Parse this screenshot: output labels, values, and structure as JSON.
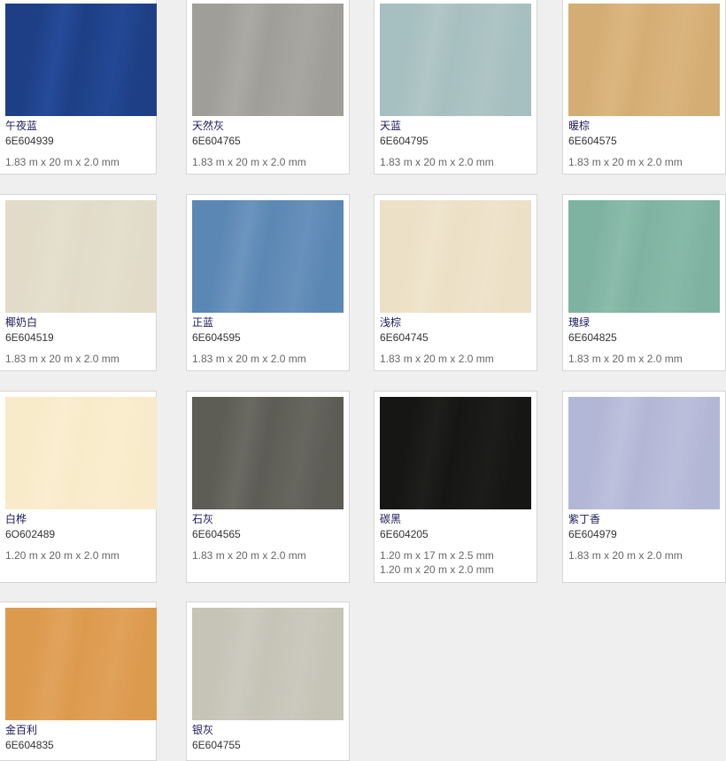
{
  "products": [
    {
      "name": "午夜蓝",
      "code": "6E604939",
      "sizes": [
        "1.83 m x 20 m x 2.0 mm"
      ],
      "color": "#1e3f85",
      "accent": "#3363c2"
    },
    {
      "name": "天然灰",
      "code": "6E604765",
      "sizes": [
        "1.83 m x 20 m x 2.0 mm"
      ],
      "color": "#a09e98",
      "accent": "#c2c0ba"
    },
    {
      "name": "天蓝",
      "code": "6E604795",
      "sizes": [
        "1.83 m x 20 m x 2.0 mm"
      ],
      "color": "#a6bfc0",
      "accent": "#c6d6d6"
    },
    {
      "name": "暖棕",
      "code": "6E604575",
      "sizes": [
        "1.83 m x 20 m x 2.0 mm"
      ],
      "color": "#d4ad74",
      "accent": "#e8cc97"
    },
    {
      "name": "椰奶白",
      "code": "6E604519",
      "sizes": [
        "1.83 m x 20 m x 2.0 mm"
      ],
      "color": "#e1dbc8",
      "accent": "#ece7d8"
    },
    {
      "name": "正蓝",
      "code": "6E604595",
      "sizes": [
        "1.83 m x 20 m x 2.0 mm"
      ],
      "color": "#5b87b4",
      "accent": "#8eb0d2"
    },
    {
      "name": "浅棕",
      "code": "6E604745",
      "sizes": [
        "1.83 m x 20 m x 2.0 mm"
      ],
      "color": "#ece0c6",
      "accent": "#f5ecda"
    },
    {
      "name": "瑰绿",
      "code": "6E604825",
      "sizes": [
        "1.83 m x 20 m x 2.0 mm"
      ],
      "color": "#7fb3a1",
      "accent": "#a5ccbd"
    },
    {
      "name": "白桦",
      "code": "6O602489",
      "sizes": [
        "1.20 m x 20 m x 2.0 mm"
      ],
      "color": "#f8ebc9",
      "accent": "#fdf4de"
    },
    {
      "name": "石灰",
      "code": "6E604565",
      "sizes": [
        "1.83 m x 20 m x 2.0 mm"
      ],
      "color": "#5d5c55",
      "accent": "#85847c"
    },
    {
      "name": "碳黑",
      "code": "6E604205",
      "sizes": [
        "1.20 m x 17 m x 2.5 mm",
        "1.20 m x 20 m x 2.0 mm"
      ],
      "color": "#161614",
      "accent": "#2e2e2b"
    },
    {
      "name": "紫丁香",
      "code": "6E604979",
      "sizes": [
        "1.83 m x 20 m x 2.0 mm"
      ],
      "color": "#b3b7d6",
      "accent": "#d2d5ea"
    },
    {
      "name": "金百利",
      "code": "6E604835",
      "sizes": [],
      "color": "#dc9a4e",
      "accent": "#eab577"
    },
    {
      "name": "银灰",
      "code": "6E604755",
      "sizes": [],
      "color": "#c6c3b7",
      "accent": "#dad8ce"
    }
  ]
}
